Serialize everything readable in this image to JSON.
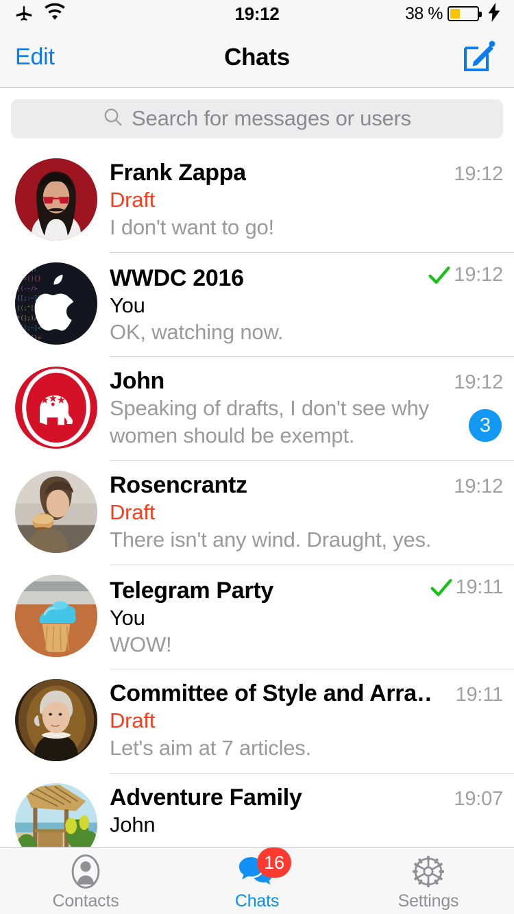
{
  "status_bar": {
    "airplane_icon": "airplane-icon",
    "wifi_icon": "wifi-icon",
    "time": "19:12",
    "battery_percent": "38 %",
    "battery_level": 38,
    "charging_icon": "lightning-bolt-icon"
  },
  "nav": {
    "edit_label": "Edit",
    "title": "Chats",
    "compose_icon": "compose-pencil-icon"
  },
  "search": {
    "icon": "search-icon",
    "placeholder": "Search for messages or users",
    "value": ""
  },
  "chats": [
    {
      "name": "Frank Zappa",
      "draft_label": "Draft",
      "sender": "",
      "message": "I don't want to go!",
      "time": "19:12",
      "checkmark": false,
      "badge": "",
      "avatar": "frank-zappa-photo"
    },
    {
      "name": "WWDC 2016",
      "draft_label": "",
      "sender": "You",
      "message": "OK, watching now.",
      "time": "19:12",
      "checkmark": true,
      "badge": "",
      "avatar": "apple-logo-photo"
    },
    {
      "name": "John",
      "draft_label": "",
      "sender": "",
      "message": "Speaking of drafts, I don't see why women should be exempt.",
      "time": "19:12",
      "checkmark": false,
      "badge": "3",
      "avatar": "republican-elephant-photo"
    },
    {
      "name": "Rosencrantz",
      "draft_label": "Draft",
      "sender": "",
      "message": "There isn't any wind. Draught, yes.",
      "time": "19:12",
      "checkmark": false,
      "badge": "",
      "avatar": "person-eating-photo"
    },
    {
      "name": "Telegram Party",
      "draft_label": "",
      "sender": "You",
      "message": "WOW!",
      "time": "19:11",
      "checkmark": true,
      "badge": "",
      "avatar": "cupcake-photo"
    },
    {
      "name": "Committee of Style and Arra…",
      "draft_label": "Draft",
      "sender": "",
      "message": "Let's aim at 7 articles.",
      "time": "19:11",
      "checkmark": false,
      "badge": "",
      "avatar": "hamilton-portrait-photo"
    },
    {
      "name": "Adventure Family",
      "draft_label": "",
      "sender": "John",
      "message": "",
      "time": "19:07",
      "checkmark": false,
      "badge": "",
      "avatar": "beach-hut-photo"
    }
  ],
  "tabs": [
    {
      "label": "Contacts",
      "icon": "contacts-person-icon",
      "badge": "",
      "active": false
    },
    {
      "label": "Chats",
      "icon": "chats-bubbles-icon",
      "badge": "16",
      "active": true
    },
    {
      "label": "Settings",
      "icon": "settings-gear-icon",
      "badge": "",
      "active": false
    }
  ],
  "colors": {
    "accent_blue": "#0b7bf0",
    "draft_red": "#f4401f",
    "check_green": "#18c018",
    "unread_badge_blue": "#1098f3",
    "tab_badge_red": "#fc3b30",
    "battery_yellow": "#fdc500"
  }
}
